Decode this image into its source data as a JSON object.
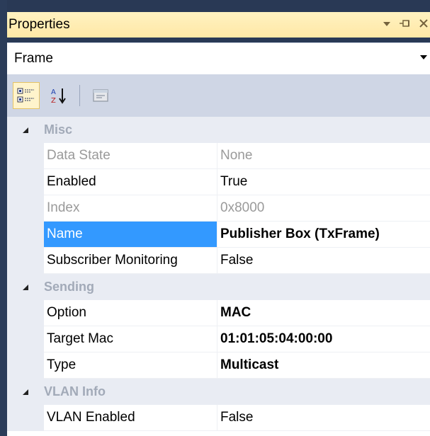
{
  "panel": {
    "title": "Properties",
    "icons": [
      "dropdown-arrow-icon",
      "pin-icon",
      "close-icon"
    ]
  },
  "selector": {
    "value": "Frame"
  },
  "toolbar": {
    "buttons": [
      "categorized-icon",
      "alphabetical-icon",
      "property-pages-icon"
    ]
  },
  "grid": {
    "categories": [
      {
        "label": "Misc",
        "properties": [
          {
            "name": "Data State",
            "value": "None"
          },
          {
            "name": "Enabled",
            "value": "True"
          },
          {
            "name": "Index",
            "value": "0x8000"
          },
          {
            "name": "Name",
            "value": "Publisher Box (TxFrame)"
          },
          {
            "name": "Subscriber Monitoring",
            "value": "False"
          }
        ]
      },
      {
        "label": "Sending",
        "properties": [
          {
            "name": "Option",
            "value": "MAC"
          },
          {
            "name": "Target Mac",
            "value": "01:01:05:04:00:00"
          },
          {
            "name": "Type",
            "value": "Multicast"
          }
        ]
      },
      {
        "label": "VLAN Info",
        "properties": [
          {
            "name": "VLAN Enabled",
            "value": "False"
          }
        ]
      }
    ]
  },
  "colors": {
    "selection": "#3399ff",
    "title_bar": "#ffe8a6",
    "toolbar": "#cfd6e5"
  }
}
